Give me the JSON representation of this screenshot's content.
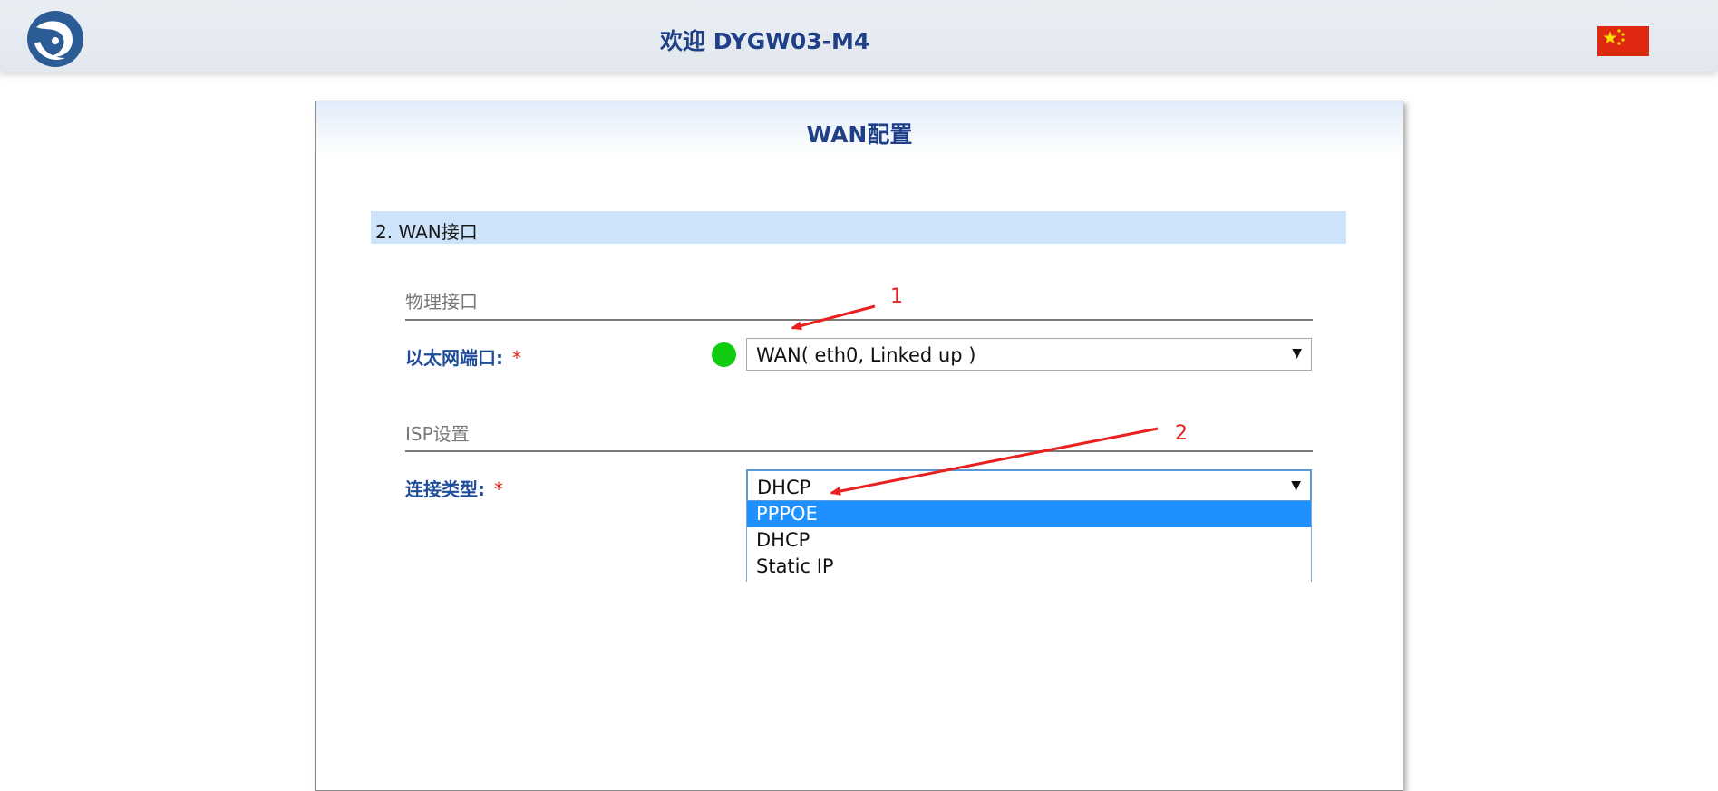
{
  "header": {
    "welcome": "欢迎 DYGW03-M4",
    "logo_icon": "swirl-logo-icon",
    "language_flag_icon": "china-flag-icon"
  },
  "panel": {
    "title": "WAN配置",
    "section_title": "2. WAN接口",
    "physical": {
      "group_title": "物理接口",
      "ethernet_label": "以太网端口:",
      "required_mark": "*",
      "status_color": "#11cc11",
      "port_value": "WAN( eth0, Linked up )"
    },
    "isp": {
      "group_title": "ISP设置",
      "connection_label": "连接类型:",
      "required_mark": "*",
      "connection_value": "DHCP",
      "options": [
        "PPPOE",
        "DHCP",
        "Static IP"
      ],
      "highlighted_option": "PPPOE"
    }
  },
  "annotations": {
    "labels": [
      "1",
      "2"
    ],
    "color": "#e82020"
  },
  "colors": {
    "title_blue": "#1f3f86",
    "label_blue": "#1f4d9a",
    "section_bg": "#cce3fa",
    "option_highlight": "#1e90ff"
  }
}
